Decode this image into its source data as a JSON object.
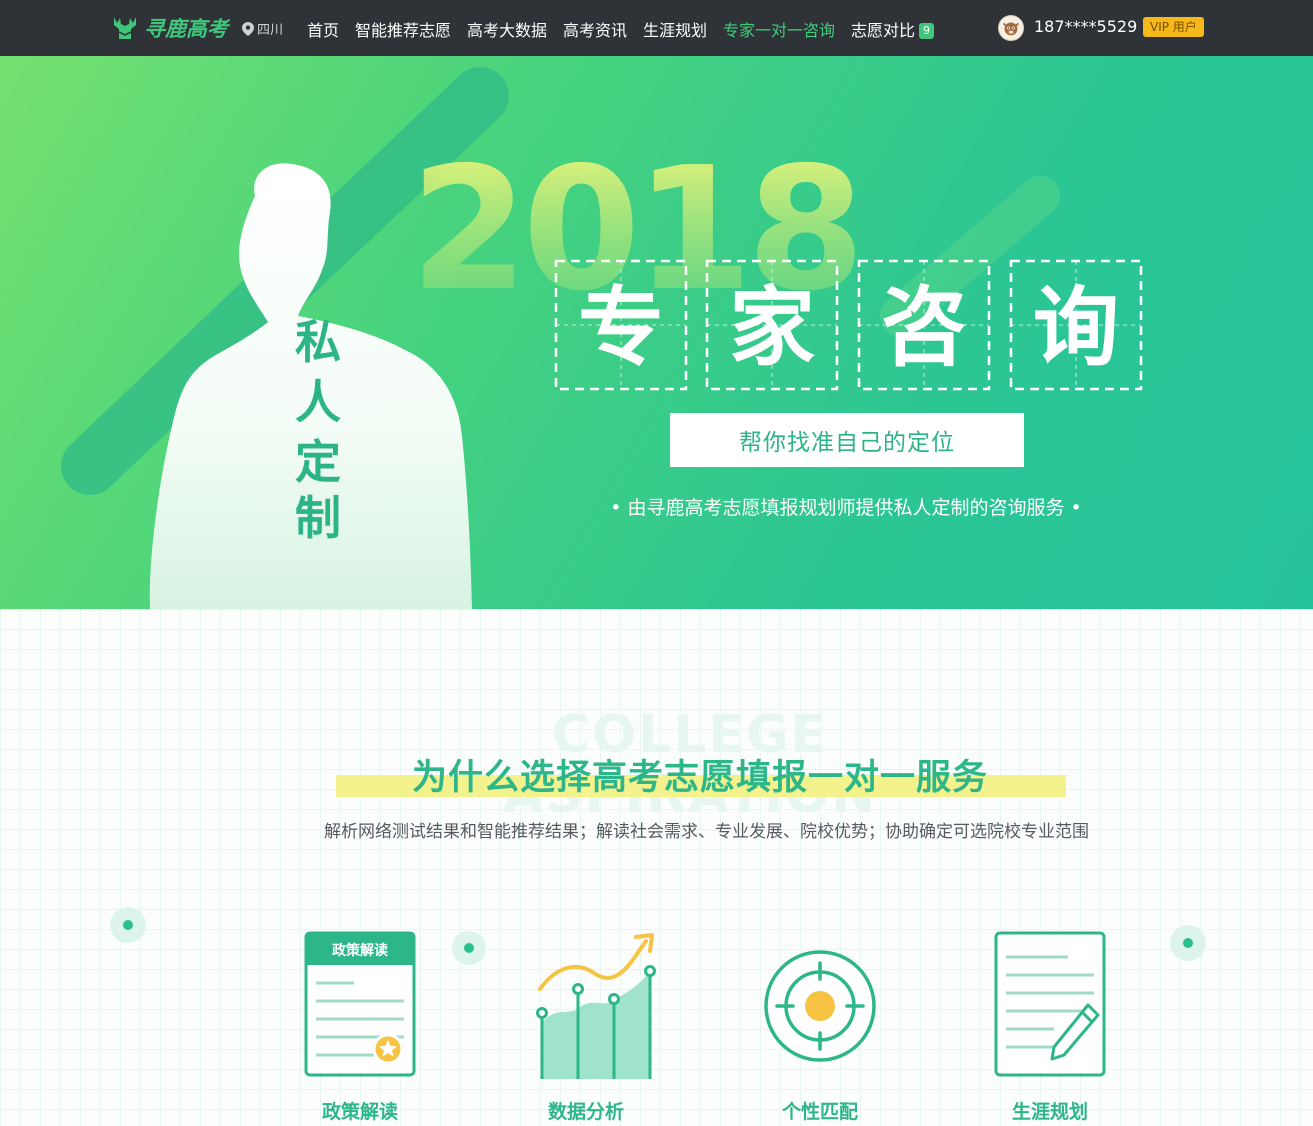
{
  "brand": {
    "logo_text": "寻鹿高考",
    "location": "四川"
  },
  "nav": {
    "items": [
      {
        "label": "首页"
      },
      {
        "label": "智能推荐志愿"
      },
      {
        "label": "高考大数据"
      },
      {
        "label": "高考资讯"
      },
      {
        "label": "生涯规划"
      },
      {
        "label": "专家一对一咨询"
      },
      {
        "label": "志愿对比",
        "badge": "9"
      }
    ],
    "active_index": 5
  },
  "user": {
    "phone": "187****5529",
    "vip_label": "VIP 用户"
  },
  "hero": {
    "year": "2018",
    "title_chars": [
      "专",
      "家",
      "咨",
      "询"
    ],
    "tag_chars": [
      "私",
      "人",
      "定",
      "制"
    ],
    "subtitle": "帮你找准自己的定位",
    "description": "• 由寻鹿高考志愿填报规划师提供私人定制的咨询服务 •"
  },
  "section": {
    "bg_text": "COLLEGE ASPIRATION",
    "title": "为什么选择高考志愿填报一对一服务",
    "description": "解析网络测试结果和智能推荐结果；解读社会需求、专业发展、院校优势；协助确定可选院校专业范围",
    "features": [
      {
        "label": "政策解读",
        "icon": "policy-document-icon",
        "card_header": "政策解读"
      },
      {
        "label": "数据分析",
        "icon": "data-chart-icon"
      },
      {
        "label": "个性匹配",
        "icon": "target-icon"
      },
      {
        "label": "生涯规划",
        "icon": "plan-document-icon"
      }
    ]
  },
  "colors": {
    "nav_bg": "#2f3237",
    "accent": "#2cb68a",
    "active_nav": "#3fcf7e",
    "vip": "#f5b91a",
    "highlight": "#f4f28c"
  }
}
